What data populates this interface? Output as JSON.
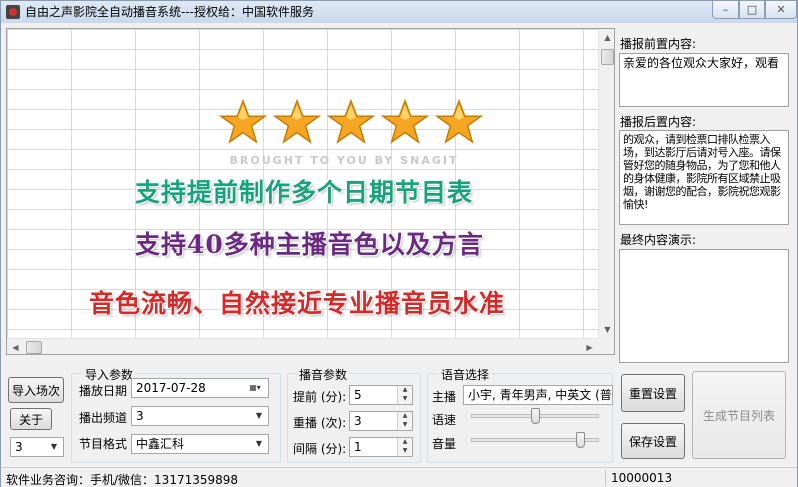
{
  "window": {
    "title": "自由之声影院全自动播音系统---授权给：中国软件服务",
    "buttons": {
      "minimize": "–",
      "maximize": "□",
      "close": "✕"
    }
  },
  "banner": {
    "star_count": 5,
    "watermark": "BROUGHT TO YOU BY SNAGIT",
    "lines": [
      "支持提前制作多个日期节目表",
      "支持40多种主播音色以及方言",
      "音色流畅、自然接近专业播音员水准"
    ],
    "colors": {
      "line1": "#17a37b",
      "line2": "#6a2a82",
      "line3": "#d42a2a",
      "star": "#f5a623"
    }
  },
  "right_panel": {
    "pre_label": "播报前置内容:",
    "pre_text": "亲爱的各位观众大家好，观看",
    "post_label": "播报后置内容:",
    "post_text": "的观众，请到检票口排队检票入场，到达影厅后请对号入座。请保管好您的随身物品，为了您和他人的身体健康，影院所有区域禁止吸烟，谢谢您的配合，影院祝您观影愉快!",
    "final_label": "最终内容演示:",
    "final_text": ""
  },
  "left_controls": {
    "import_button": "导入场次",
    "about_button": "关于",
    "count_value": "3"
  },
  "import_group": {
    "title": "导入参数",
    "date_label": "播放日期",
    "date_value": "2017-07-28",
    "channel_label": "播出频道",
    "channel_value": "3",
    "format_label": "节目格式",
    "format_value": "中鑫汇科"
  },
  "broadcast_group": {
    "title": "播音参数",
    "advance_label": "提前 (分):",
    "advance_value": "5",
    "repeat_label": "重播 (次):",
    "repeat_value": "3",
    "interval_label": "间隔 (分):",
    "interval_value": "1"
  },
  "voice_group": {
    "title": "语音选择",
    "anchor_label": "主播",
    "anchor_value": "小宇, 青年男声, 中英文 (普",
    "speed_label": "语速",
    "speed_level": 0.5,
    "volume_label": "音量",
    "volume_level": 0.88
  },
  "action_buttons": {
    "reset": "重置设置",
    "save": "保存设置",
    "generate": "生成节目列表"
  },
  "statusbar": {
    "contact": "软件业务咨询：手机/微信：13171359898",
    "code": "10000013"
  }
}
